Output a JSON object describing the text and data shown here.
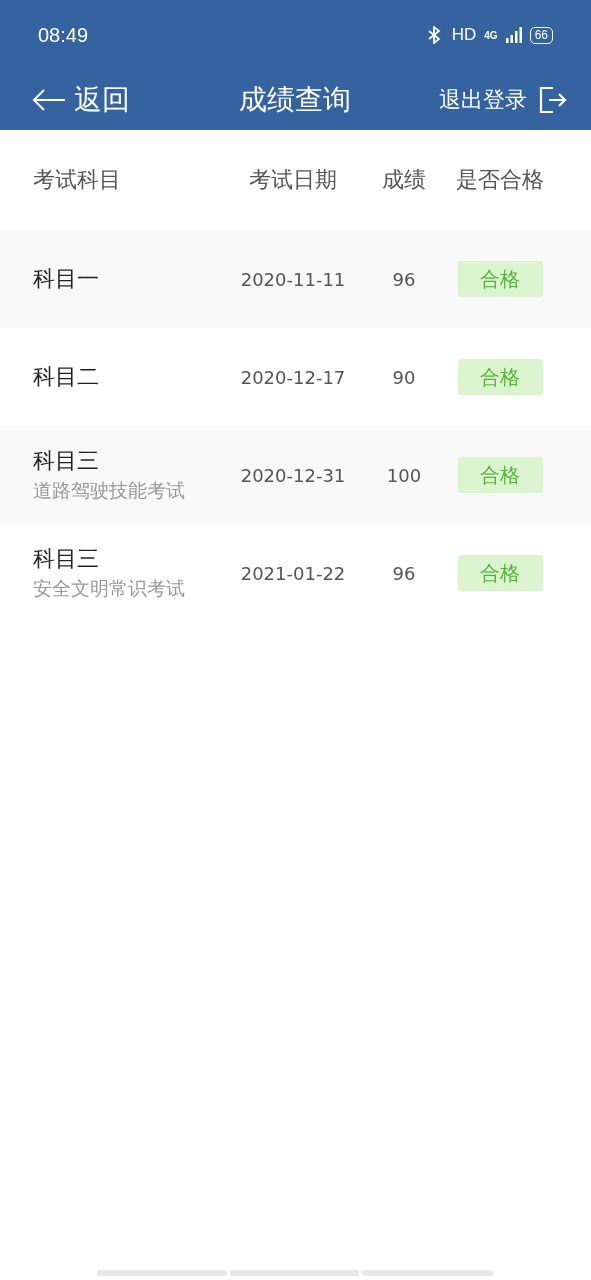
{
  "status_bar": {
    "time": "08:49",
    "hd": "HD",
    "network": "4G",
    "battery": "66"
  },
  "header": {
    "back": "返回",
    "title": "成绩查询",
    "logout": "退出登录"
  },
  "table": {
    "columns": [
      "考试科目",
      "考试日期",
      "成绩",
      "是否合格"
    ],
    "rows": [
      {
        "subject": "科目一",
        "date": "2020-11-11",
        "score": "96",
        "result": "合格",
        "passed": true
      },
      {
        "subject": "科目二",
        "date": "2020-12-17",
        "score": "90",
        "result": "合格",
        "passed": true
      },
      {
        "subject": "科目三",
        "note": "道路驾驶技能考试",
        "date": "2020-12-31",
        "score": "100",
        "result": "合格",
        "passed": true
      },
      {
        "subject": "科目三",
        "note": "安全文明常识考试",
        "date": "2021-01-22",
        "score": "96",
        "result": "合格",
        "passed": true
      }
    ]
  }
}
